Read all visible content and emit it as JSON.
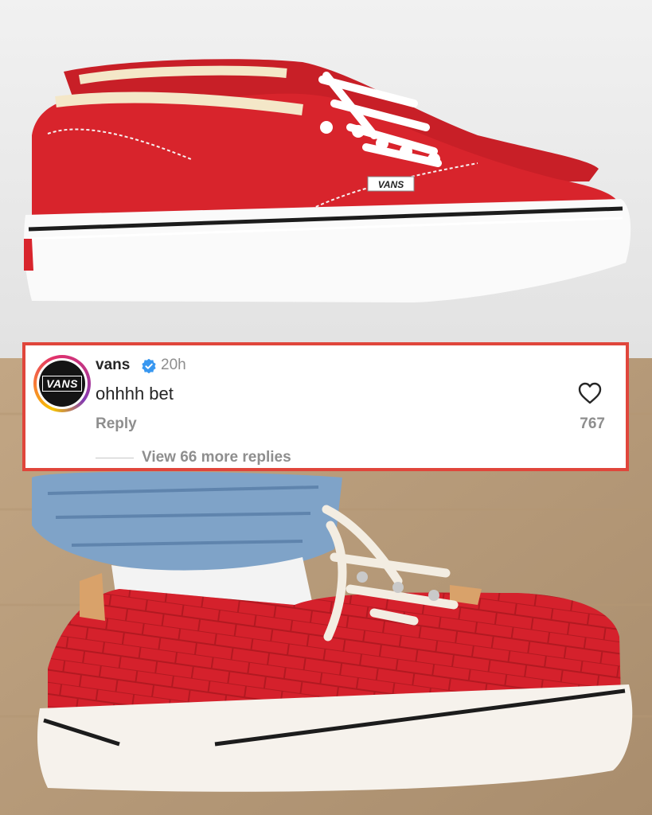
{
  "comment": {
    "avatar_text": "VANS",
    "username": "vans",
    "time": "20h",
    "text": "ohhhh bet",
    "reply_label": "Reply",
    "likes": "767",
    "view_replies": "View 66 more replies"
  },
  "top_shoe": {
    "logo_text": "VANS"
  },
  "colors": {
    "highlight_border": "#e0463b",
    "verified_blue": "#3897f0",
    "shoe_red": "#d8242c"
  }
}
